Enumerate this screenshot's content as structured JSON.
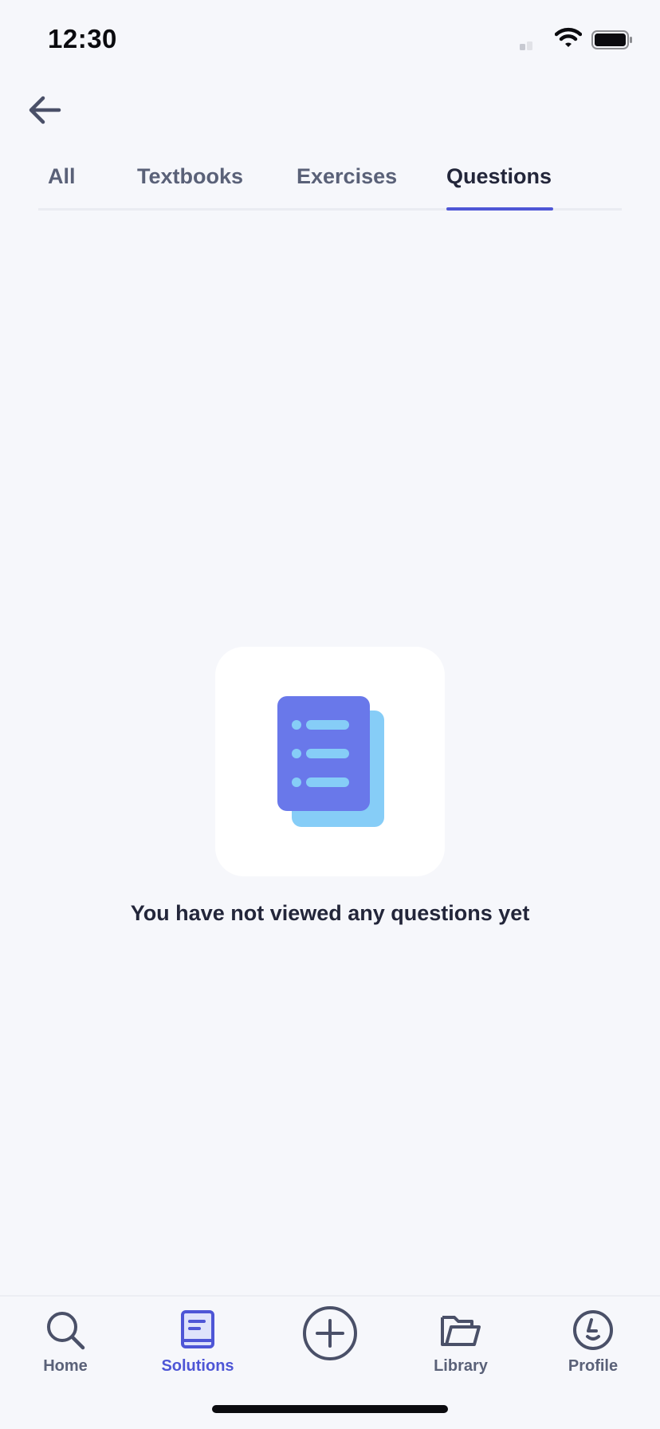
{
  "status_bar": {
    "time": "12:30",
    "icons": [
      "signal-icon",
      "wifi-icon",
      "battery-icon"
    ]
  },
  "tabs": [
    {
      "label": "All",
      "active": false
    },
    {
      "label": "Textbooks",
      "active": false
    },
    {
      "label": "Exercises",
      "active": false
    },
    {
      "label": "Questions",
      "active": true
    }
  ],
  "empty_state": {
    "message": "You have not viewed any questions yet",
    "icon": "document-list-icon"
  },
  "bottom_nav": [
    {
      "label": "Home",
      "icon": "search-icon",
      "active": false
    },
    {
      "label": "Solutions",
      "icon": "solutions-book-icon",
      "active": true
    },
    {
      "label": "",
      "icon": "add-icon",
      "active": false
    },
    {
      "label": "Library",
      "icon": "folder-icon",
      "active": false
    },
    {
      "label": "Profile",
      "icon": "profile-icon",
      "active": false
    }
  ],
  "colors": {
    "accent": "#4e56d6",
    "background": "#f6f7fb",
    "doc_front": "#6978ea",
    "doc_back": "#86cdf7",
    "text_primary": "#23263a",
    "text_secondary": "#5a6178"
  }
}
